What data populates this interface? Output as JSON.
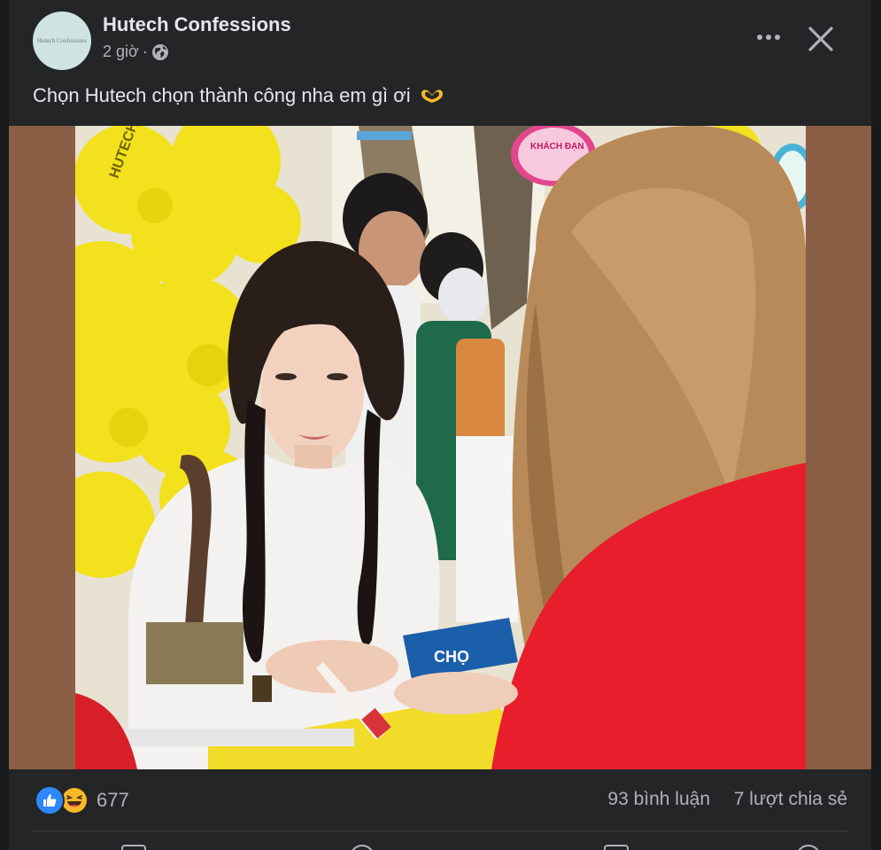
{
  "post": {
    "page_name": "Hutech Confessions",
    "avatar_text": "Hutech Confessions",
    "time": "2 giờ",
    "separator": "·",
    "audience_icon": "globe-icon",
    "caption": "Chọn Hutech chọn thành công nha em gì ơi",
    "caption_emoji": "heart-hands-emoji"
  },
  "controls": {
    "more_icon": "more-horizontal-icon",
    "close_icon": "close-icon"
  },
  "photo": {
    "balloon_text": "HUTECH",
    "brochure_text": "CHỌ",
    "sign_text": "KHÁCH ĐẠN"
  },
  "stats": {
    "reaction_icons": [
      "like-icon",
      "haha-icon"
    ],
    "reaction_count": "677",
    "comments": "93 bình luận",
    "shares": "7 lượt chia sẻ"
  },
  "colors": {
    "card_bg": "#242526",
    "page_bg": "#18191a",
    "text_primary": "#e4e6eb",
    "text_secondary": "#b0b3b8",
    "media_letterbox": "#8a5f45",
    "like_blue": "#2d88ff",
    "haha_yellow": "#f7b928"
  }
}
